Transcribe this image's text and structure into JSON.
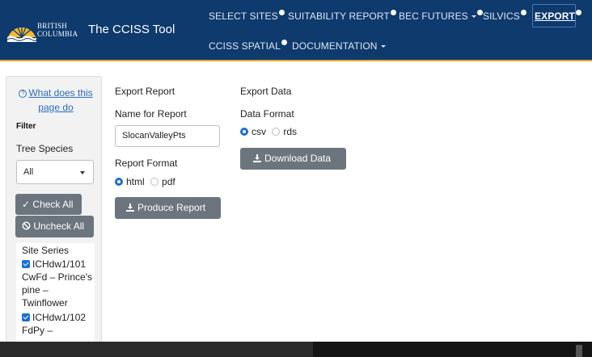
{
  "header": {
    "logo_text_line1": "BRITISH",
    "logo_text_line2": "COLUMBIA",
    "app_title": "The CCISS Tool",
    "nav": [
      {
        "label": "SELECT SITES",
        "badge": true,
        "dropdown": false
      },
      {
        "label": "SUITABILITY REPORT",
        "badge": true,
        "dropdown": false
      },
      {
        "label": "BEC FUTURES",
        "badge": true,
        "dropdown": true
      },
      {
        "label": "SILVICS",
        "badge": true,
        "dropdown": false
      },
      {
        "label": "EXPORT",
        "badge": true,
        "dropdown": false,
        "active": true
      },
      {
        "label": "CCISS SPATIAL",
        "badge": true,
        "dropdown": false
      },
      {
        "label": "DOCUMENTATION",
        "badge": false,
        "dropdown": true
      }
    ],
    "colors": {
      "background": "#0e3a6e",
      "accent": "#e3a82b"
    }
  },
  "sidebar": {
    "help_link": "What does this page do",
    "filter_label": "Filter",
    "tree_species_label": "Tree Species",
    "tree_species_value": "All",
    "check_all": "Check All",
    "uncheck_all": "Uncheck All",
    "site_series_label": "Site Series",
    "site_series": [
      {
        "label": "ICHdw1/101 CwFd – Prince's pine – Twinflower",
        "checked": true
      },
      {
        "label": "ICHdw1/102 FdPy –",
        "checked": true
      }
    ]
  },
  "export_report": {
    "heading": "Export Report",
    "name_label": "Name for Report",
    "name_value": "SlocanValleyPts",
    "format_label": "Report Format",
    "formats": [
      {
        "label": "html",
        "selected": true
      },
      {
        "label": "pdf",
        "selected": false
      }
    ],
    "button": "Produce Report"
  },
  "export_data": {
    "heading": "Export Data",
    "format_label": "Data Format",
    "formats": [
      {
        "label": "csv",
        "selected": true
      },
      {
        "label": "rds",
        "selected": false
      }
    ],
    "button": "Download Data"
  }
}
